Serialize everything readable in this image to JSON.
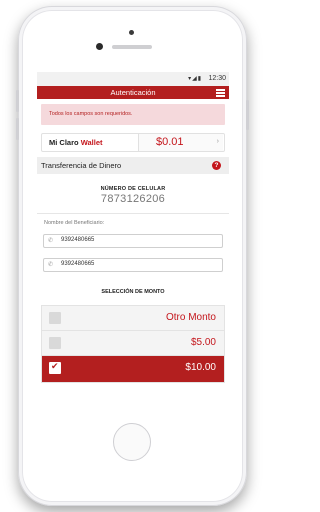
{
  "status_bar": {
    "time": "12:30",
    "icons": [
      "wifi-icon",
      "signal-icon",
      "battery-icon"
    ]
  },
  "header": {
    "title": "Autenticación"
  },
  "alert": {
    "text": "Todos los campos son requeridos."
  },
  "wallet": {
    "label_prefix": "Mi Claro",
    "label_brand": "Wallet",
    "balance": "$0.01"
  },
  "section": {
    "title": "Transferencia de Dinero",
    "help": "?"
  },
  "phone": {
    "label": "NÚMERO DE CELULAR",
    "value": "7873126206"
  },
  "beneficiary": {
    "label": "Nombre del Beneficiario:",
    "field1_value": "9392480665",
    "field2_value": "9392480665"
  },
  "amount": {
    "label": "SELECCIÓN DE MONTO",
    "options": [
      {
        "label": "Otro Monto",
        "selected": false
      },
      {
        "label": "$5.00",
        "selected": false
      },
      {
        "label": "$10.00",
        "selected": true
      }
    ]
  },
  "colors": {
    "brand_red": "#b31f1f",
    "accent_red": "#c4161c",
    "alert_bg": "#f5d9dc"
  }
}
